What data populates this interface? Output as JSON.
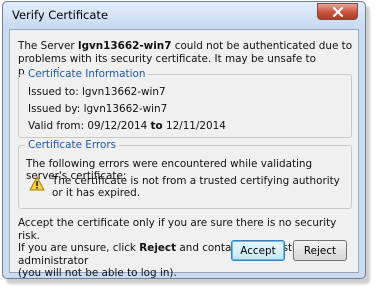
{
  "window": {
    "title": "Verify Certificate",
    "close_icon": "close-icon"
  },
  "intro": {
    "prefix": "The Server ",
    "server": "lgvn13662-win7",
    "suffix": " could not be authenticated due to problems with its security certificate. It may be unsafe to proceed."
  },
  "cert_info": {
    "legend": "Certificate Information",
    "issued_to_label": "Issued to:",
    "issued_to": "lgvn13662-win7",
    "issued_by_label": "Issued by:",
    "issued_by": "lgvn13662-win7",
    "valid_from_label": "Valid from:",
    "valid_from": "09/12/2014",
    "valid_to_word": "to",
    "valid_to": "12/11/2014"
  },
  "cert_errors": {
    "legend": "Certificate Errors",
    "text": "The following errors were encountered while validating server's certificate:",
    "icon": "warning-icon",
    "error": "The certificate is not from a trusted certifying authority or it has expired."
  },
  "footer": {
    "line1": "Accept the certificate only if you are sure there is no security risk.",
    "line2_prefix": "If you are unsure, click ",
    "line2_bold": "Reject",
    "line2_suffix": " and contact your system administrator",
    "line3": "(you will not be able to log in)."
  },
  "buttons": {
    "accept": "Accept",
    "reject": "Reject"
  },
  "colors": {
    "legend": "#1a5aa8",
    "close": "#c9523c"
  }
}
